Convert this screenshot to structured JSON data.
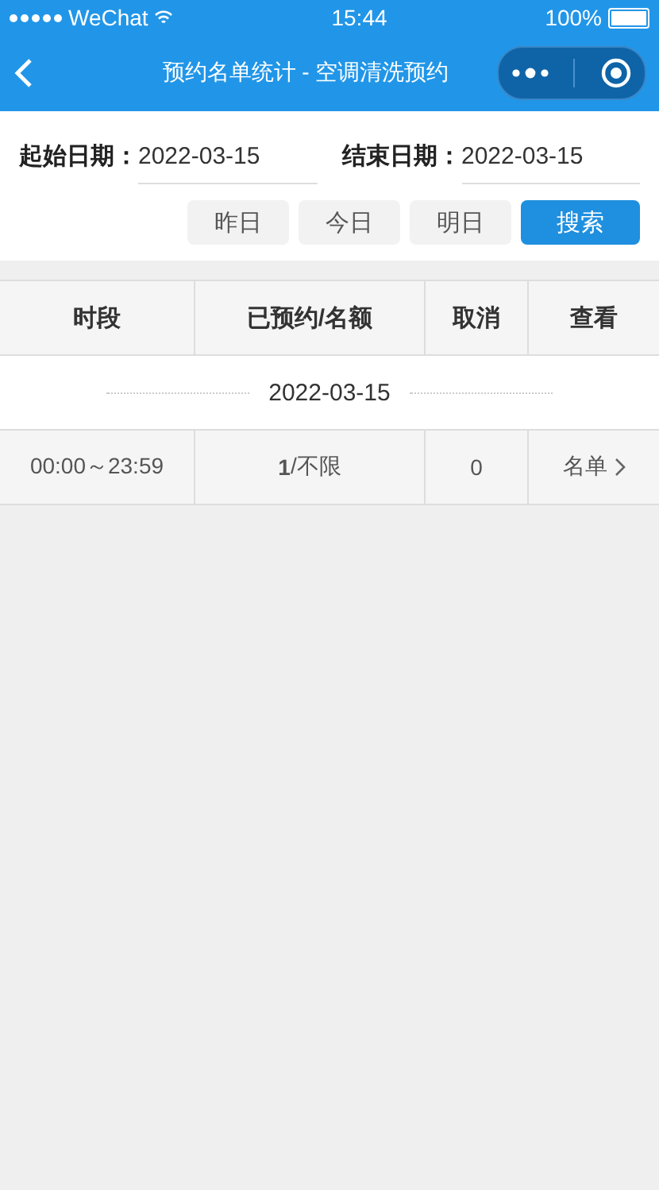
{
  "status_bar": {
    "carrier": "WeChat",
    "time": "15:44",
    "battery": "100%"
  },
  "nav_bar": {
    "title": "预约名单统计 - 空调清洗预约"
  },
  "filters": [
    {
      "label": "起始日期：",
      "value": "2022-03-15"
    },
    {
      "label": "结束日期：",
      "value": "2022-03-15"
    }
  ],
  "day_buttons": [
    "昨日",
    "今日",
    "明日"
  ],
  "search_button": "搜索",
  "table": {
    "columns": [
      "时段",
      "已预约/名额",
      "取消",
      "查看"
    ],
    "groups": [
      {
        "date": "2022-03-15",
        "rows": [
          {
            "time": "00:00～23:59",
            "booked": "**1**/不限",
            "cancelled": "0",
            "view": "名单"
          }
        ]
      }
    ]
  }
}
